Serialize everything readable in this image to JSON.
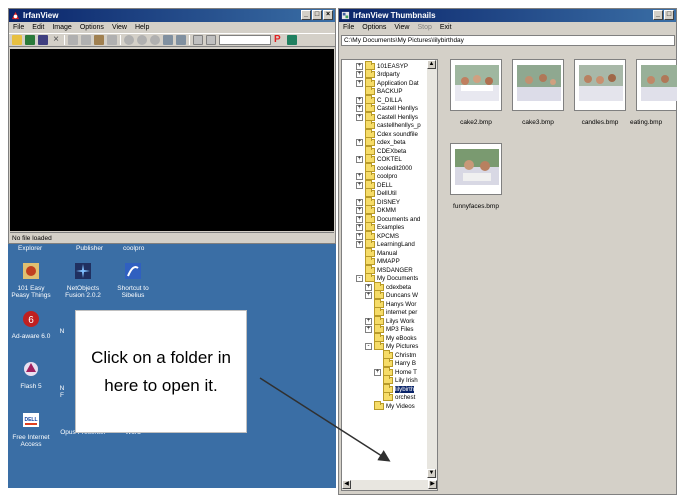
{
  "irfanview": {
    "title": "IrfanView",
    "menu": [
      "File",
      "Edit",
      "Image",
      "Options",
      "View",
      "Help"
    ],
    "status": "No file loaded"
  },
  "desktop": {
    "top_labels": [
      "Explorer",
      "Publisher",
      "coolpro"
    ],
    "icons": [
      {
        "label": "101 Easy Peasy Things",
        "icon": "app-icon"
      },
      {
        "label": "NetObjects Fusion 2.0.2",
        "icon": "netobjects-icon"
      },
      {
        "label": "Shortcut to Sibelius",
        "icon": "sibelius-icon"
      },
      {
        "label": "Ad-aware 6.0",
        "icon": "adaware-icon"
      },
      {
        "label": "N",
        "icon": "app-icon"
      },
      {
        "label": "Flash 5",
        "icon": "flash-icon"
      },
      {
        "label": "N",
        "icon": "app-icon"
      },
      {
        "label": "F",
        "icon": "app-icon"
      },
      {
        "label": "Free Internet Access",
        "icon": "dell-icon"
      },
      {
        "label": "Opus Presenter",
        "icon": "opus-icon"
      },
      {
        "label": "Word",
        "icon": "word-icon"
      }
    ]
  },
  "thumbnails": {
    "title": "IrfanView Thumbnails",
    "menu": [
      "File",
      "Options",
      "View",
      "Stop",
      "Exit"
    ],
    "path": "C:\\My Documents\\My Pictures\\lilybirthday",
    "tree": [
      {
        "label": "101EASYP",
        "expander": "+"
      },
      {
        "label": "3rdparty",
        "expander": "+"
      },
      {
        "label": "Application Dat",
        "expander": "+"
      },
      {
        "label": "BACKUP",
        "expander": ""
      },
      {
        "label": "C_DILLA",
        "expander": "+"
      },
      {
        "label": "Castell Henllys",
        "expander": "+"
      },
      {
        "label": "Castell Henllys",
        "expander": "+"
      },
      {
        "label": "castellhenllys_p",
        "expander": ""
      },
      {
        "label": "Cdex soundfile",
        "expander": ""
      },
      {
        "label": "cdex_beta",
        "expander": "+"
      },
      {
        "label": "CDEXbeta",
        "expander": ""
      },
      {
        "label": "COKTEL",
        "expander": "+"
      },
      {
        "label": "cooledit2000",
        "expander": ""
      },
      {
        "label": "coolpro",
        "expander": "+"
      },
      {
        "label": "DELL",
        "expander": "+"
      },
      {
        "label": "DellUtil",
        "expander": ""
      },
      {
        "label": "DISNEY",
        "expander": "+"
      },
      {
        "label": "DKMM",
        "expander": "+"
      },
      {
        "label": "Documents and",
        "expander": "+"
      },
      {
        "label": "Examples",
        "expander": "+"
      },
      {
        "label": "KPCMS",
        "expander": "+"
      },
      {
        "label": "LearningLand",
        "expander": "+"
      },
      {
        "label": "Manual",
        "expander": ""
      },
      {
        "label": "MMAPP",
        "expander": ""
      },
      {
        "label": "MSDANGER",
        "expander": ""
      },
      {
        "label": "My Documents",
        "expander": "-"
      },
      {
        "label": "cdexbeta",
        "expander": "+",
        "level": 1
      },
      {
        "label": "Duncans W",
        "expander": "+",
        "level": 1
      },
      {
        "label": "Hanys Wor",
        "expander": "",
        "level": 1
      },
      {
        "label": "internet per",
        "expander": "",
        "level": 1
      },
      {
        "label": "Lilys Work",
        "expander": "+",
        "level": 1
      },
      {
        "label": "MP3 Files",
        "expander": "+",
        "level": 1
      },
      {
        "label": "My eBooks",
        "expander": "",
        "level": 1
      },
      {
        "label": "My Pictures",
        "expander": "-",
        "level": 1
      },
      {
        "label": "Christm",
        "expander": "",
        "level": 2
      },
      {
        "label": "Harry B",
        "expander": "",
        "level": 2
      },
      {
        "label": "Home T",
        "expander": "+",
        "level": 2
      },
      {
        "label": "Lily Irish",
        "expander": "",
        "level": 2
      },
      {
        "label": "lilybirth",
        "expander": "",
        "level": 2,
        "selected": true
      },
      {
        "label": "orchest",
        "expander": "",
        "level": 2
      },
      {
        "label": "My Videos",
        "expander": "",
        "level": 1
      }
    ],
    "images": [
      {
        "name": "cake2.bmp"
      },
      {
        "name": "cake3.bmp"
      },
      {
        "name": "candles.bmp"
      },
      {
        "name": "eating.bmp"
      },
      {
        "name": "funnyfaces.bmp"
      }
    ]
  },
  "callout": {
    "text": "Click on a folder in here to open it."
  }
}
